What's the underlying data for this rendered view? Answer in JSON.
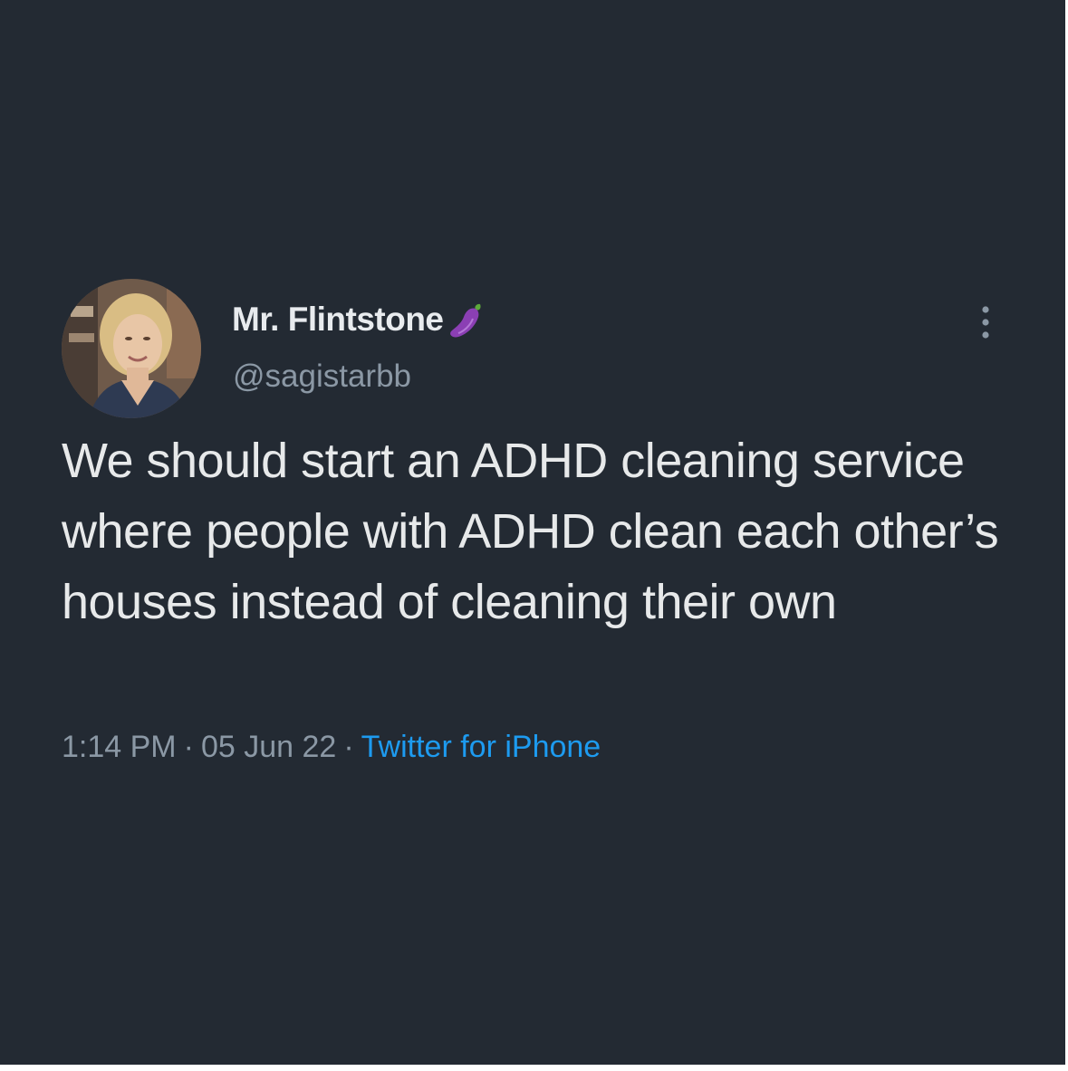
{
  "tweet": {
    "author": {
      "display_name": "Mr. Flintstone",
      "handle": "@sagistarbb",
      "name_emoji_icon": "eggplant-icon"
    },
    "text": "We should start an ADHD cleaning service where people with ADHD clean each other’s houses instead of cleaning their own",
    "meta": {
      "time": "1:14 PM",
      "separator": "·",
      "date": "05 Jun 22",
      "source": "Twitter for iPhone"
    },
    "menu_icon": "more-vertical-icon"
  },
  "colors": {
    "background": "#232a33",
    "primary_text": "#e7e9ea",
    "secondary_text": "#8b98a5",
    "link": "#1d9bf0",
    "emoji": "#8b3fb4"
  }
}
